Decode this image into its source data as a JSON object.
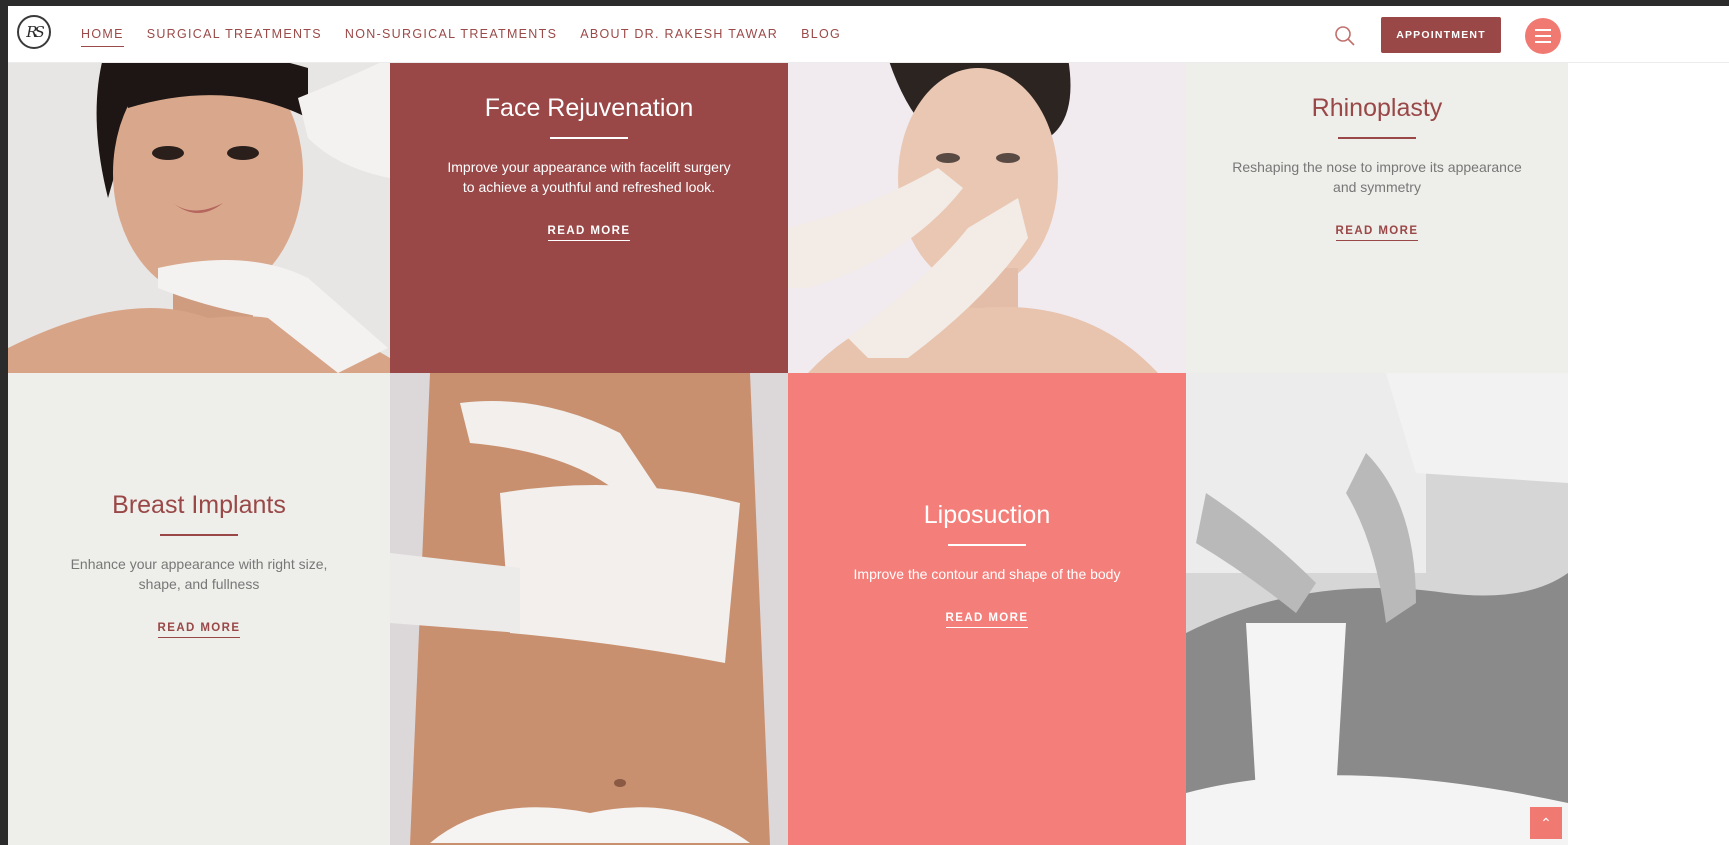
{
  "nav": {
    "logo_text": "RS",
    "items": [
      {
        "label": "HOME",
        "active": true
      },
      {
        "label": "SURGICAL TREATMENTS",
        "active": false
      },
      {
        "label": "NON-SURGICAL TREATMENTS",
        "active": false
      },
      {
        "label": "ABOUT DR. RAKESH TAWAR",
        "active": false
      },
      {
        "label": "BLOG",
        "active": false
      }
    ],
    "appointment_label": "APPOINTMENT",
    "search_icon": "search-icon",
    "menu_icon": "hamburger-menu-icon"
  },
  "tiles": {
    "face": {
      "title": "Face Rejuvenation",
      "desc": "Improve your appearance with facelift surgery to achieve a youthful and refreshed look.",
      "link": "READ MORE"
    },
    "rhino": {
      "title": "Rhinoplasty",
      "desc": "Reshaping the nose to improve its appearance and symmetry",
      "link": "READ MORE"
    },
    "breast": {
      "title": "Breast Implants",
      "desc": "Enhance your appearance with right size, shape, and fullness",
      "link": "READ MORE"
    },
    "lipo": {
      "title": "Liposuction",
      "desc": "Improve the contour and shape of the body",
      "link": "READ MORE"
    }
  },
  "colors": {
    "brand_dark_red": "#994747",
    "coral": "#f47f7a",
    "light_grey": "#eeeeea",
    "nav_text": "#9a4a48"
  },
  "scroll_top_icon": "chevron-up-icon"
}
